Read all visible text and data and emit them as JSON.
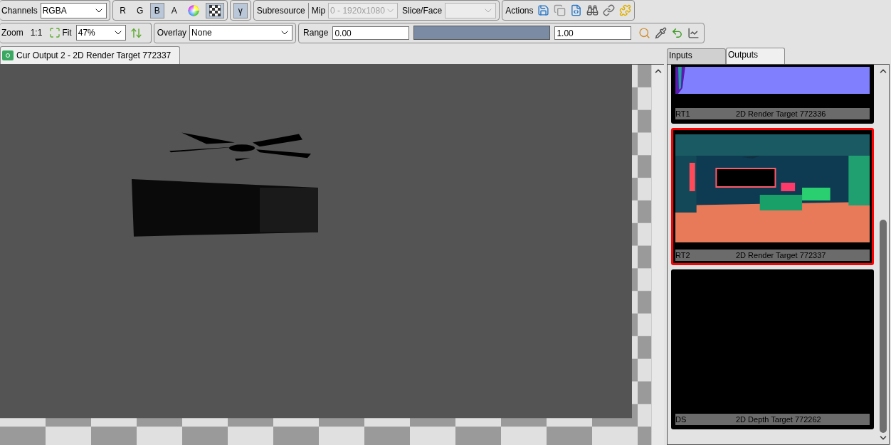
{
  "toolbar": {
    "channels": {
      "label": "Channels",
      "value": "RGBA"
    },
    "channel_buttons": [
      {
        "label": "R",
        "selected": false
      },
      {
        "label": "G",
        "selected": false
      },
      {
        "label": "B",
        "selected": true
      },
      {
        "label": "A",
        "selected": false
      }
    ],
    "view_toggles": [
      {
        "kind": "color_wheel",
        "selected": false
      },
      {
        "kind": "checkerboard",
        "selected": true
      }
    ],
    "gamma": {
      "label": "γ",
      "selected": true
    },
    "subresource": {
      "label": "Subresource",
      "mip_label": "Mip",
      "mip_value": "0 - 1920x1080",
      "slice_label": "Slice/Face"
    },
    "actions": {
      "label": "Actions"
    },
    "zoom": {
      "label": "Zoom",
      "one_to_one": "1:1",
      "fit": "Fit",
      "value": "47%"
    },
    "overlay": {
      "label": "Overlay",
      "value": "None"
    },
    "range": {
      "label": "Range",
      "min": "0.00",
      "max": "1.00",
      "level": 1
    }
  },
  "viewer_tab": {
    "title": "Cur Output 2 - 2D Render Target 772337",
    "selected": true
  },
  "side_tabs": [
    {
      "label": "Inputs",
      "selected": false
    },
    {
      "label": "Outputs",
      "selected": true
    }
  ],
  "thumbnails": [
    {
      "name": "RT1",
      "title": "2D Render Target 772336",
      "selected": false,
      "kind": "normals"
    },
    {
      "name": "RT2",
      "title": "2D Render Target 772337",
      "selected": true,
      "kind": "scene"
    },
    {
      "name": "DS",
      "title": "2D Depth Target 772262",
      "selected": false,
      "kind": "depth"
    }
  ]
}
